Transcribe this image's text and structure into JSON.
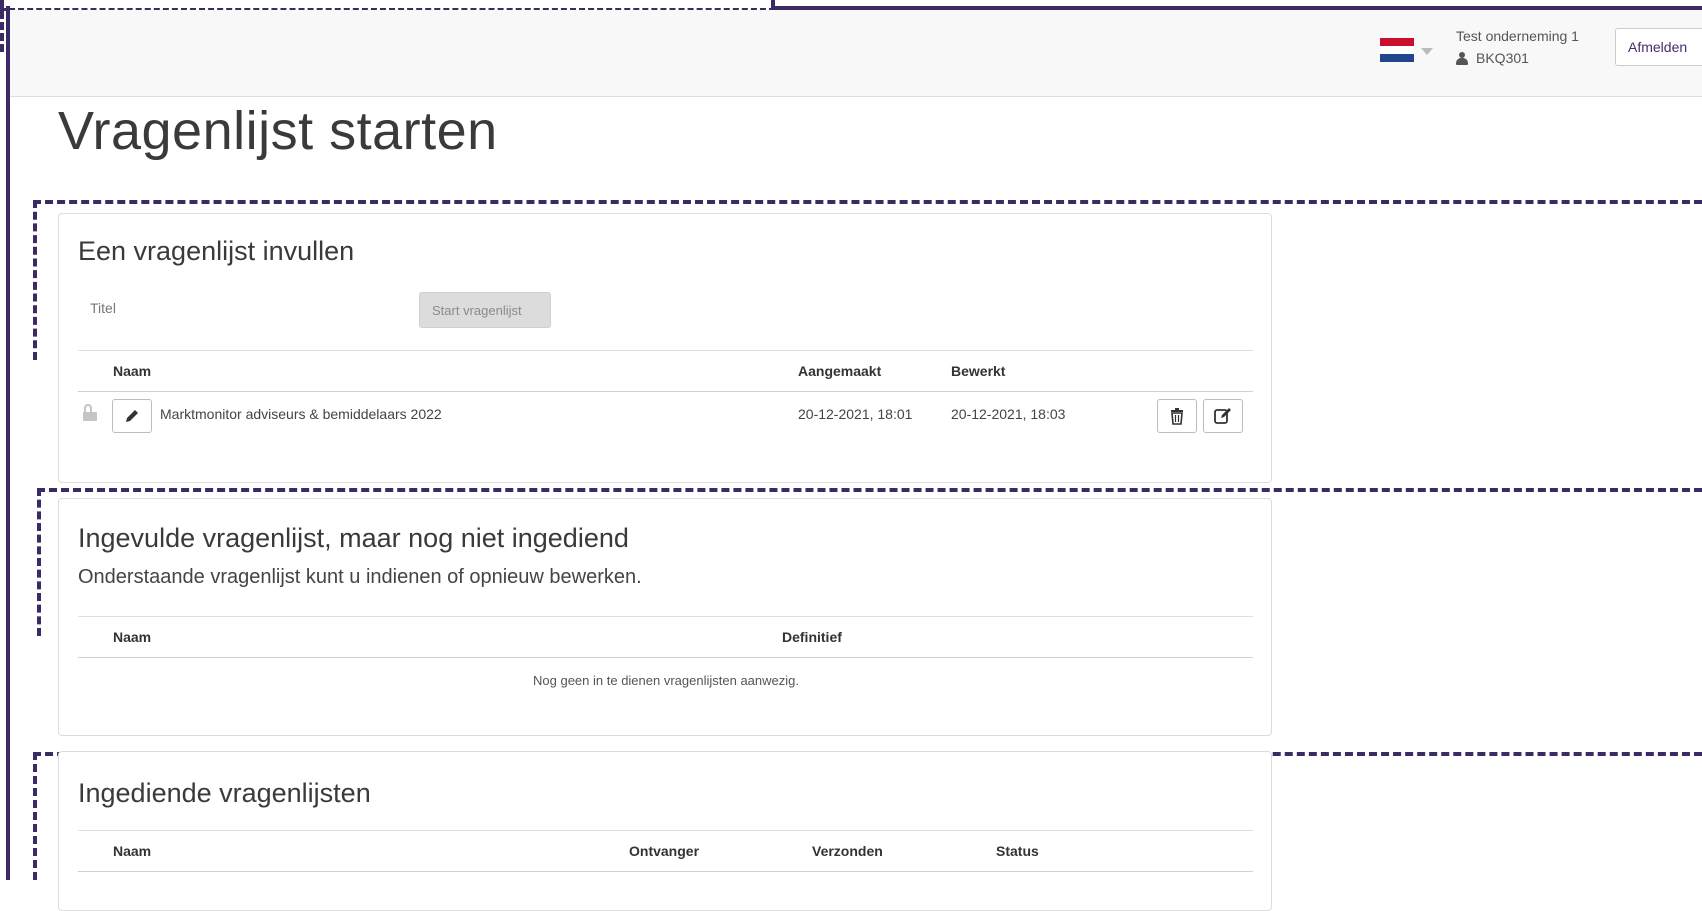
{
  "header": {
    "company": "Test onderneming 1",
    "user_id": "BKQ301",
    "logout_label": "Afmelden",
    "language_flag": "dutch-flag-icon"
  },
  "page": {
    "title": "Vragenlijst starten"
  },
  "section_fill": {
    "heading": "Een vragenlijst invullen",
    "title_placeholder": "Titel",
    "start_button": "Start vragenlijst",
    "columns": {
      "name": "Naam",
      "created": "Aangemaakt",
      "edited": "Bewerkt"
    },
    "rows": [
      {
        "name": "Marktmonitor adviseurs & bemiddelaars 2022",
        "created": "20-12-2021, 18:01",
        "edited": "20-12-2021, 18:03"
      }
    ]
  },
  "section_pending": {
    "heading": "Ingevulde vragenlijst, maar nog niet ingediend",
    "subtitle": "Onderstaande vragenlijst kunt u indienen of opnieuw bewerken.",
    "columns": {
      "name": "Naam",
      "final": "Definitief"
    },
    "empty_message": "Nog geen in te dienen vragenlijsten aanwezig."
  },
  "section_submitted": {
    "heading": "Ingediende vragenlijsten",
    "columns": {
      "name": "Naam",
      "recipient": "Ontvanger",
      "sent": "Verzonden",
      "status": "Status"
    }
  },
  "colors": {
    "accent": "#3b2a63",
    "brand_text": "#4a2b6b"
  }
}
